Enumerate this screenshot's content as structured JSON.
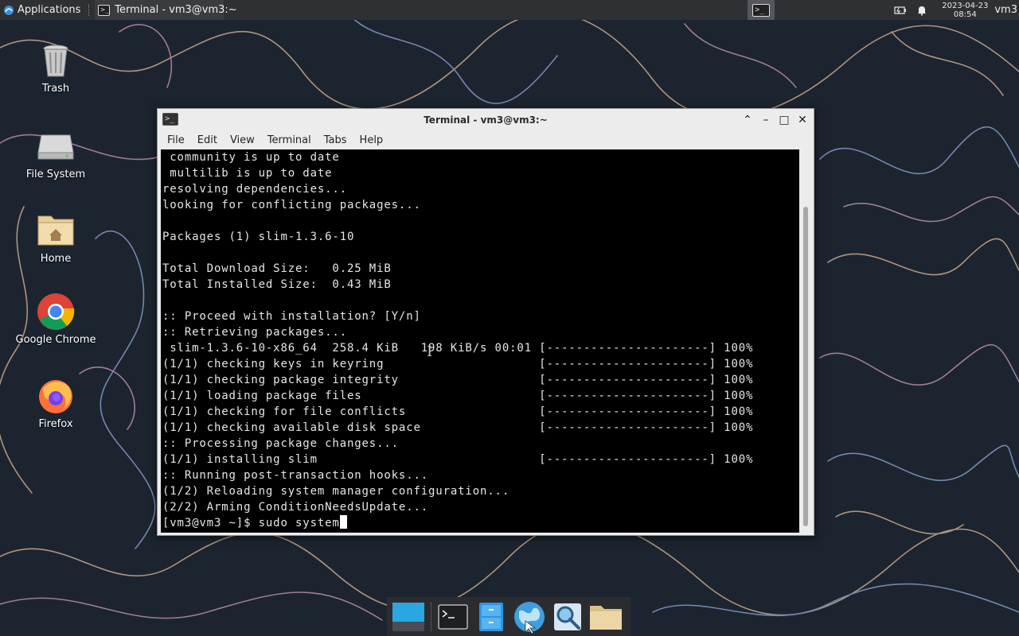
{
  "top_panel": {
    "applications_label": "Applications",
    "task_title": "Terminal - vm3@vm3:~",
    "clock_date": "2023-04-23",
    "clock_time": "08:54",
    "user": "vm3"
  },
  "desktop_icons": [
    {
      "label": "Trash",
      "icon": "trash-icon"
    },
    {
      "label": "File System",
      "icon": "drive-icon"
    },
    {
      "label": "Home",
      "icon": "home-folder-icon"
    },
    {
      "label": "Google Chrome",
      "icon": "chrome-icon"
    },
    {
      "label": "Firefox",
      "icon": "firefox-icon"
    }
  ],
  "window": {
    "title": "Terminal - vm3@vm3:~",
    "menu": [
      "File",
      "Edit",
      "View",
      "Terminal",
      "Tabs",
      "Help"
    ]
  },
  "terminal": {
    "lines": [
      " community is up to date",
      " multilib is up to date",
      "resolving dependencies...",
      "looking for conflicting packages...",
      "",
      "Packages (1) slim-1.3.6-10",
      "",
      "Total Download Size:   0.25 MiB",
      "Total Installed Size:  0.43 MiB",
      "",
      ":: Proceed with installation? [Y/n]",
      ":: Retrieving packages...",
      " slim-1.3.6-10-x86_64  258.4 KiB   198 KiB/s 00:01 [----------------------] 100%",
      "(1/1) checking keys in keyring                     [----------------------] 100%",
      "(1/1) checking package integrity                   [----------------------] 100%",
      "(1/1) loading package files                        [----------------------] 100%",
      "(1/1) checking for file conflicts                  [----------------------] 100%",
      "(1/1) checking available disk space                [----------------------] 100%",
      ":: Processing package changes...",
      "(1/1) installing slim                              [----------------------] 100%",
      ":: Running post-transaction hooks...",
      "(1/2) Reloading system manager configuration...",
      "(2/2) Arming ConditionNeedsUpdate..."
    ],
    "prompt_line": "[vm3@vm3 ~]$ sudo system"
  },
  "dock": [
    "show-desktop-icon",
    "terminal-icon",
    "file-manager-icon",
    "web-browser-icon",
    "search-icon",
    "folder-icon"
  ],
  "colors": {
    "desktop_bg": "#1c2430",
    "panel_bg": "#2f3033",
    "terminal_bg": "#000000",
    "terminal_fg": "#e6e6e6"
  }
}
